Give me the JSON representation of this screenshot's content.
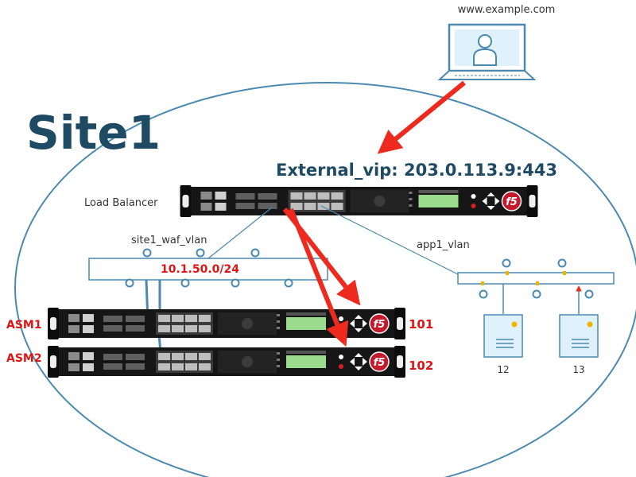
{
  "site_label": "Site1",
  "client": {
    "url": "www.example.com",
    "icon": "user-at-computer-icon"
  },
  "external_vip": "External_vip: 203.0.113.9:443",
  "load_balancer": {
    "label": "Load Balancer",
    "vendor_logo": "f5"
  },
  "vlans": {
    "waf": {
      "name": "site1_waf_vlan",
      "subnet": "10.1.50.0/24"
    },
    "app": {
      "name": "app1_vlan"
    }
  },
  "asm_devices": [
    {
      "name": "ASM1",
      "id": "101"
    },
    {
      "name": "ASM2",
      "id": "102"
    }
  ],
  "servers": [
    {
      "id": "12"
    },
    {
      "id": "13"
    }
  ],
  "colors": {
    "site_text": "#1f4a63",
    "line_blue": "#4a8ab0",
    "arrow_red": "#ee2a1e",
    "device_body": "#161616",
    "f5_red": "#c41a2e",
    "label_red": "#e01414",
    "server_fill": "#dff1fb",
    "pin_yellow": "#f0b300"
  }
}
